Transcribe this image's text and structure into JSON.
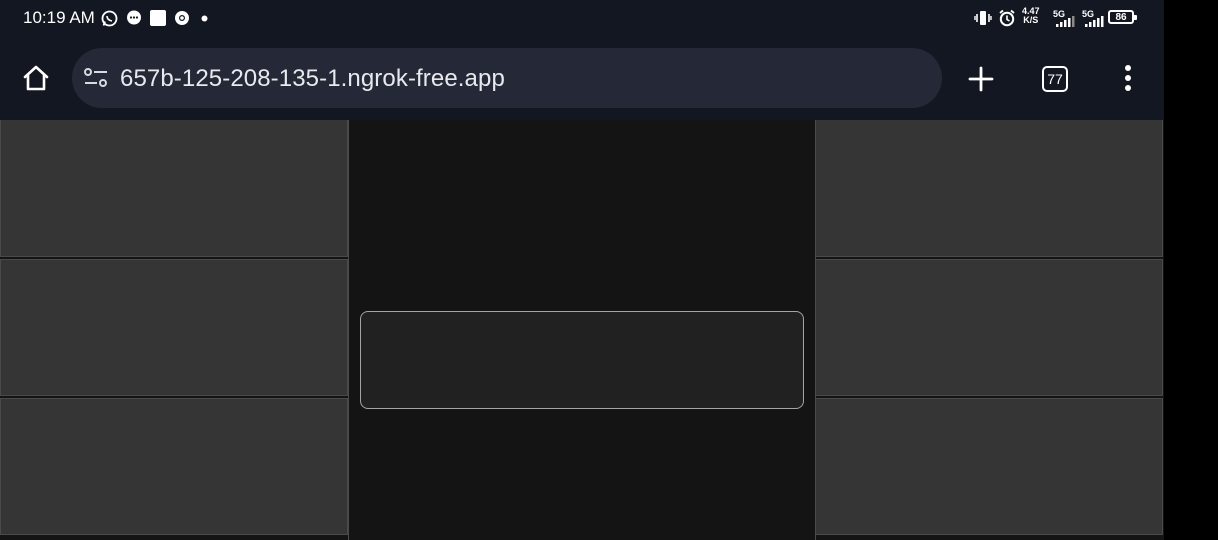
{
  "status_bar": {
    "time": "10:19 AM",
    "notification_icons": [
      "whatsapp-icon",
      "message-icon",
      "app-square-icon",
      "chrome-icon",
      "dot-icon"
    ],
    "net_speed_value": "4.47",
    "net_speed_unit": "K/S",
    "sim1_label": "5G",
    "sim2_label": "5G",
    "battery": "86"
  },
  "browser": {
    "url": "657b-125-208-135-1.ngrok-free.app",
    "tab_count": "77",
    "icons": {
      "home": "home-icon",
      "site_info": "tune-icon",
      "new_tab": "plus-icon",
      "tabs": "tab-switcher-icon",
      "menu": "more-vert-icon"
    }
  },
  "page": {
    "left_tiles": [
      "",
      "",
      ""
    ],
    "right_tiles": [
      "",
      "",
      ""
    ],
    "input_value": ""
  },
  "colors": {
    "status_bg": "#131722",
    "urlbar_bg": "#252937",
    "page_bg": "#141414",
    "tile_bg": "#353535",
    "input_bg": "#212121",
    "input_border": "#a4a4a4"
  }
}
